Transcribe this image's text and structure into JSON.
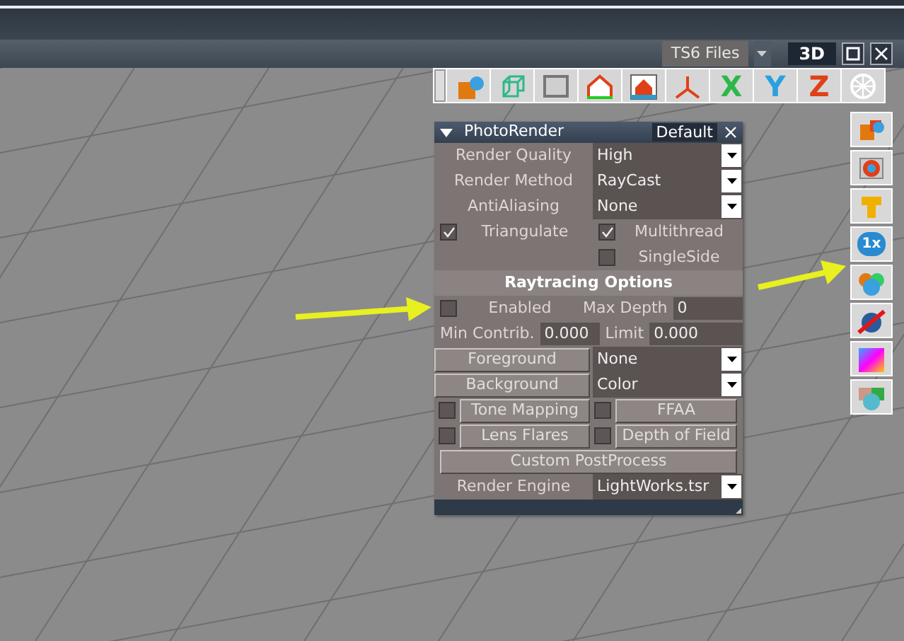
{
  "header": {
    "files_label": "TS6 Files",
    "view_label": "3D"
  },
  "toolbar": {
    "axis_buttons": [
      {
        "label": "X",
        "color": "#2db84a"
      },
      {
        "label": "Y",
        "color": "#2aa0e0"
      },
      {
        "label": "Z",
        "color": "#e04018"
      }
    ]
  },
  "side_toolbar": {
    "scale_badge": "1x"
  },
  "panel": {
    "title": "PhotoRender",
    "preset": "Default",
    "rows": [
      {
        "kind": "select",
        "label": "Render Quality",
        "value": "High"
      },
      {
        "kind": "select",
        "label": "Render Method",
        "value": "RayCast"
      },
      {
        "kind": "select",
        "label": "AntiAliasing",
        "value": "None"
      },
      {
        "kind": "check_pair",
        "items": [
          {
            "label": "Triangulate",
            "checked": true
          },
          {
            "label": "Multithread",
            "checked": true
          }
        ]
      },
      {
        "kind": "check_right",
        "label": "SingleSide",
        "checked": false
      },
      {
        "kind": "heading",
        "label": "Raytracing Options"
      },
      {
        "kind": "check_field",
        "label": "Enabled",
        "checked": false,
        "field_label": "Max Depth",
        "value": "0"
      },
      {
        "kind": "field_pair",
        "items": [
          {
            "label": "Min Contrib.",
            "value": "0.000"
          },
          {
            "label": "Limit",
            "value": "0.000"
          }
        ]
      },
      {
        "kind": "button_select",
        "label": "Foreground",
        "value": "None"
      },
      {
        "kind": "button_select",
        "label": "Background",
        "value": "Color"
      },
      {
        "kind": "check_buttons",
        "items": [
          {
            "label": "Tone Mapping",
            "checked": false
          },
          {
            "label": "FFAA",
            "checked": false
          }
        ]
      },
      {
        "kind": "check_buttons",
        "items": [
          {
            "label": "Lens Flares",
            "checked": false
          },
          {
            "label": "Depth of Field",
            "checked": false
          }
        ]
      },
      {
        "kind": "wide_button",
        "label": "Custom PostProcess"
      },
      {
        "kind": "select",
        "label": "Render Engine",
        "value": "LightWorks.tsr"
      }
    ]
  }
}
